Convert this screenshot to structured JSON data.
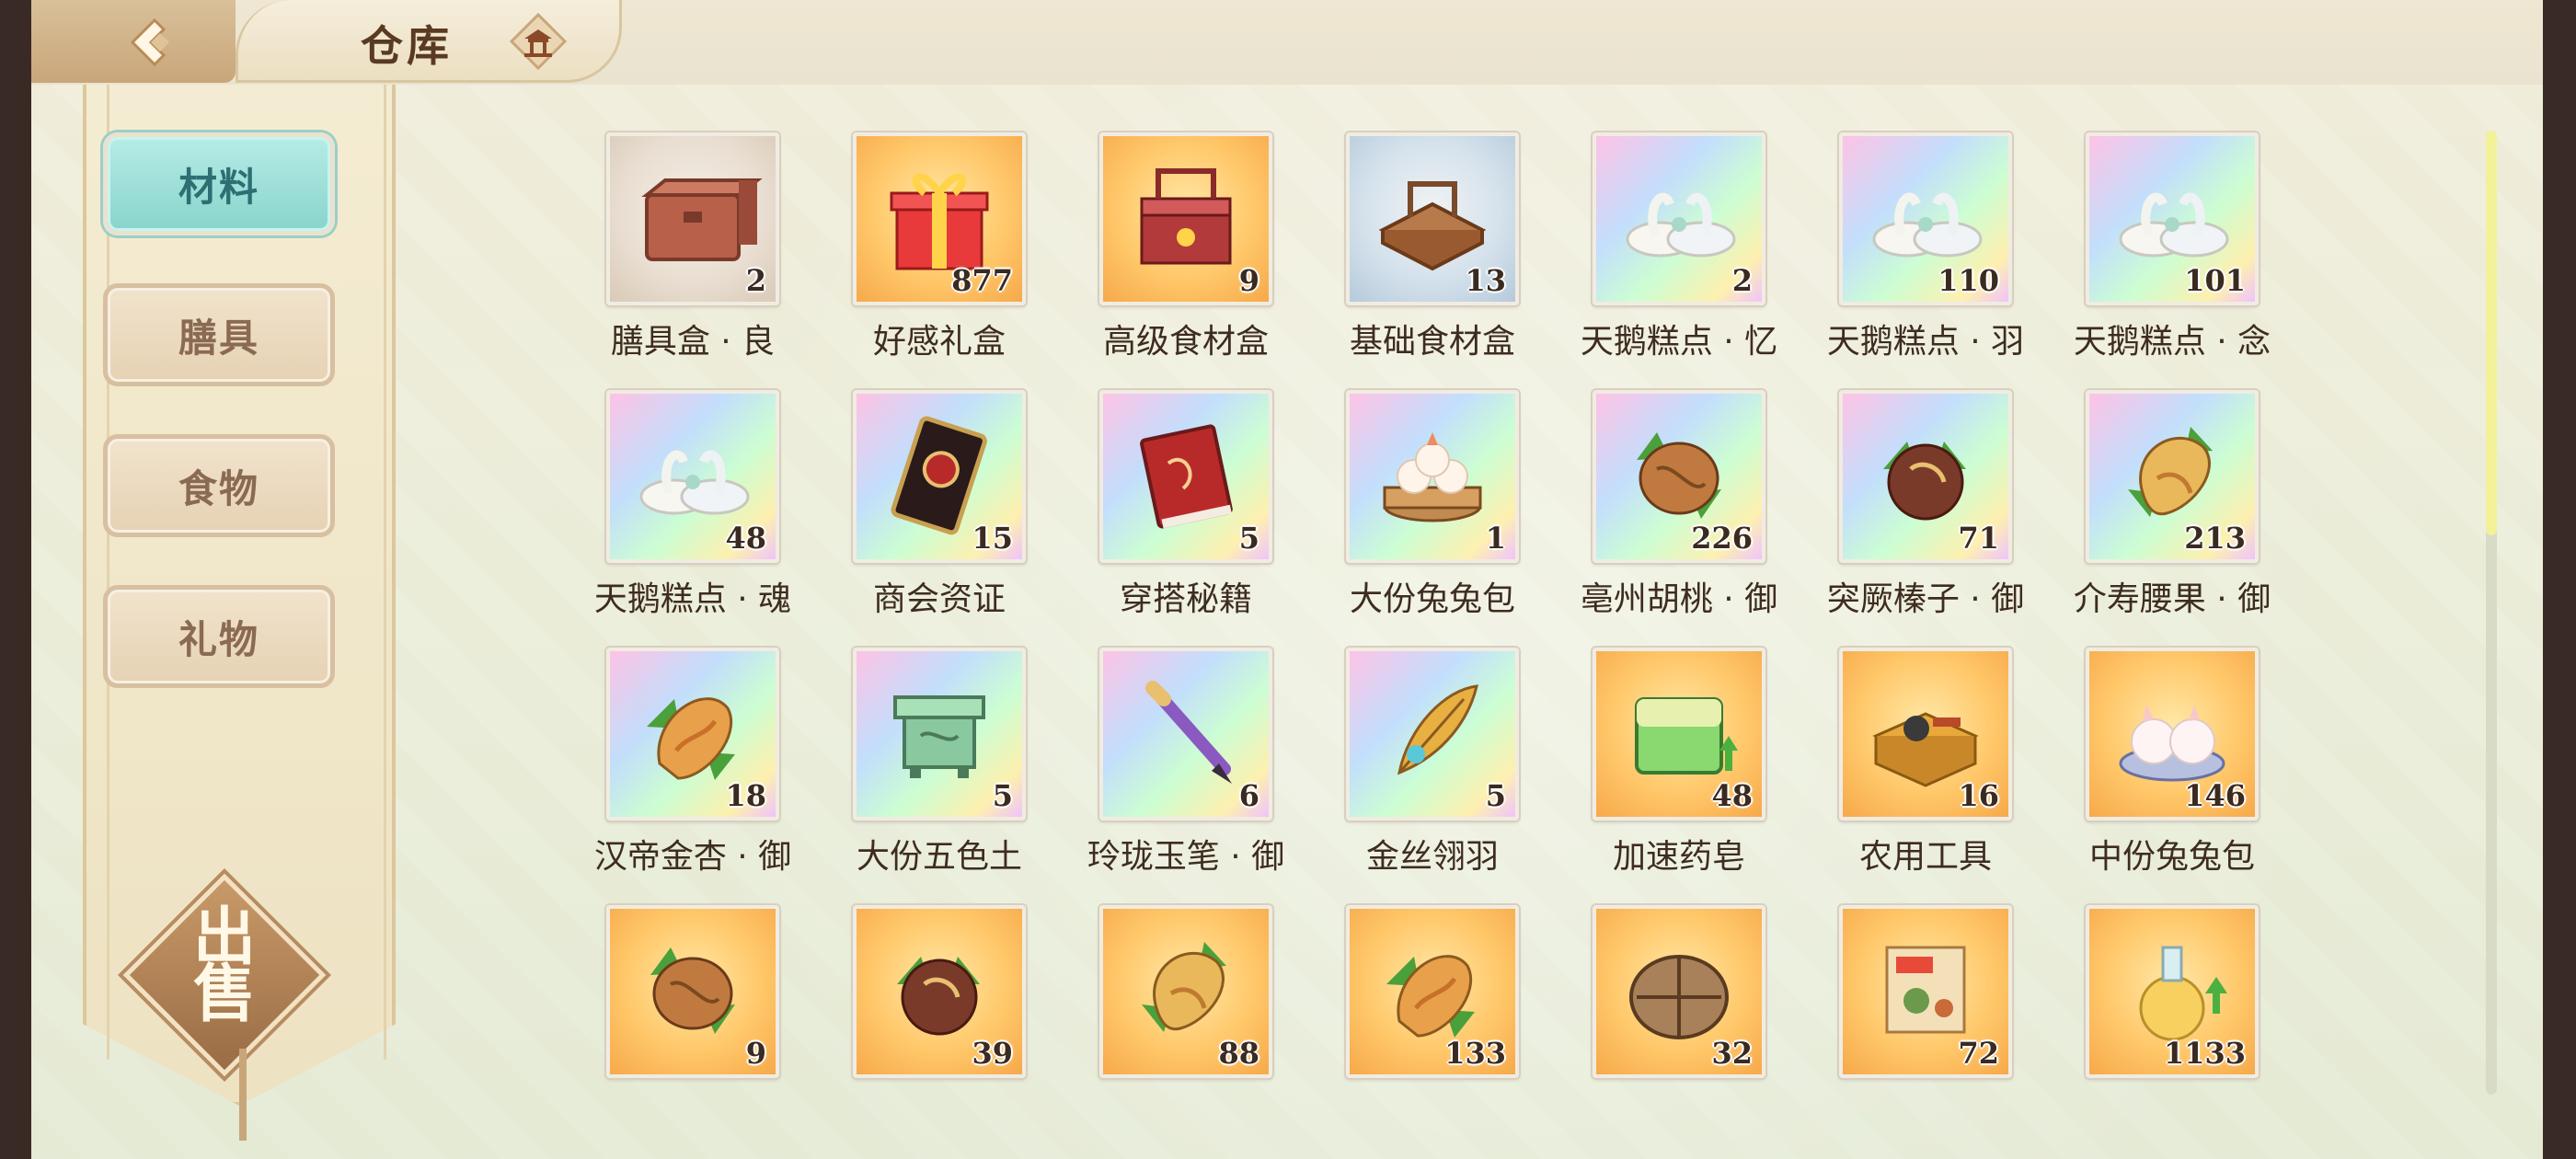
{
  "header": {
    "title": "仓库",
    "back_icon": "back-arrow-icon",
    "home_icon": "pavilion-home-icon"
  },
  "sidebar": {
    "tabs": [
      {
        "label": "材料",
        "active": true
      },
      {
        "label": "膳具",
        "active": false
      },
      {
        "label": "食物",
        "active": false
      },
      {
        "label": "礼物",
        "active": false
      }
    ],
    "sell": {
      "label_top": "出",
      "label_bottom": "售"
    }
  },
  "colors": {
    "accent_teal": "#88d4cc",
    "tab_text": "#8a6a52",
    "title_text": "#5a3a22"
  },
  "items": [
    {
      "name": "膳具盒 · 良",
      "count": "2",
      "bg": "gray",
      "icon": "chest-icon"
    },
    {
      "name": "好感礼盒",
      "count": "877",
      "bg": "orange",
      "icon": "gift-box-icon"
    },
    {
      "name": "高级食材盒",
      "count": "9",
      "bg": "orange",
      "icon": "food-basket-icon"
    },
    {
      "name": "基础食材盒",
      "count": "13",
      "bg": "blue",
      "icon": "wooden-tray-icon"
    },
    {
      "name": "天鹅糕点 · 忆",
      "count": "2",
      "bg": "rainbow",
      "icon": "swan-pastry-icon"
    },
    {
      "name": "天鹅糕点 · 羽",
      "count": "110",
      "bg": "rainbow",
      "icon": "swan-pastry-icon"
    },
    {
      "name": "天鹅糕点 · 念",
      "count": "101",
      "bg": "rainbow",
      "icon": "swan-pastry-icon"
    },
    {
      "name": "天鹅糕点 · 魂",
      "count": "48",
      "bg": "rainbow",
      "icon": "swan-pastry-icon"
    },
    {
      "name": "商会资证",
      "count": "15",
      "bg": "rainbow",
      "icon": "card-icon"
    },
    {
      "name": "穿搭秘籍",
      "count": "5",
      "bg": "rainbow",
      "icon": "book-icon"
    },
    {
      "name": "大份兔兔包",
      "count": "1",
      "bg": "rainbow",
      "icon": "bun-steamer-icon"
    },
    {
      "name": "亳州胡桃 · 御",
      "count": "226",
      "bg": "rainbow",
      "icon": "walnut-icon"
    },
    {
      "name": "突厥榛子 · 御",
      "count": "71",
      "bg": "rainbow",
      "icon": "hazelnut-icon"
    },
    {
      "name": "介寿腰果 · 御",
      "count": "213",
      "bg": "rainbow",
      "icon": "cashew-icon"
    },
    {
      "name": "汉帝金杏 · 御",
      "count": "18",
      "bg": "rainbow",
      "icon": "apricot-icon"
    },
    {
      "name": "大份五色土",
      "count": "5",
      "bg": "rainbow",
      "icon": "soil-vessel-icon"
    },
    {
      "name": "玲珑玉笔 · 御",
      "count": "6",
      "bg": "rainbow",
      "icon": "brush-icon"
    },
    {
      "name": "金丝翎羽",
      "count": "5",
      "bg": "rainbow",
      "icon": "feather-icon"
    },
    {
      "name": "加速药皂",
      "count": "48",
      "bg": "orange",
      "icon": "soap-icon"
    },
    {
      "name": "农用工具",
      "count": "16",
      "bg": "orange",
      "icon": "toolbox-icon"
    },
    {
      "name": "中份兔兔包",
      "count": "146",
      "bg": "orange",
      "icon": "rabbit-bun-icon"
    },
    {
      "name": "",
      "count": "9",
      "bg": "orange",
      "icon": "walnut-icon"
    },
    {
      "name": "",
      "count": "39",
      "bg": "orange",
      "icon": "hazelnut-icon"
    },
    {
      "name": "",
      "count": "88",
      "bg": "orange",
      "icon": "cashew-icon"
    },
    {
      "name": "",
      "count": "133",
      "bg": "orange",
      "icon": "apricot-icon"
    },
    {
      "name": "",
      "count": "32",
      "bg": "orange",
      "icon": "sack-icon"
    },
    {
      "name": "",
      "count": "72",
      "bg": "orange",
      "icon": "scroll-map-icon"
    },
    {
      "name": "",
      "count": "1133",
      "bg": "orange",
      "icon": "potion-icon"
    }
  ],
  "scroll_position": 0.0
}
